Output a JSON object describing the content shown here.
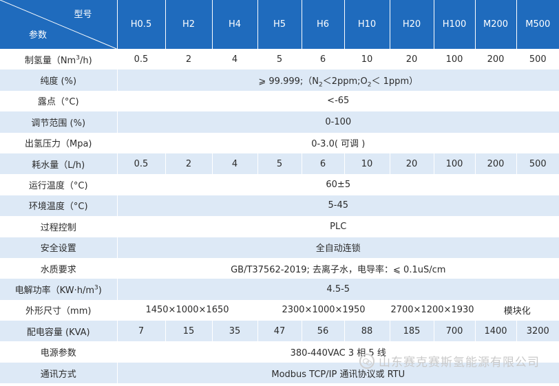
{
  "header": {
    "corner_top": "型号",
    "corner_bottom": "参数",
    "models": [
      "H0.5",
      "H2",
      "H4",
      "H5",
      "H6",
      "H10",
      "H20",
      "H100",
      "M200",
      "M500"
    ]
  },
  "rows": {
    "flow": {
      "label_pre": "制氢量（Nm",
      "label_sup": "3",
      "label_post": "/h)",
      "values": [
        "0.5",
        "2",
        "4",
        "5",
        "6",
        "10",
        "20",
        "100",
        "200",
        "500"
      ]
    },
    "purity": {
      "label": "纯度 (%)",
      "v_pre": "⩾ 99.999;（N",
      "v_sub1": "2",
      "v_mid1": "＜2ppm;O",
      "v_sub2": "2",
      "v_post": "＜ 1ppm）"
    },
    "dew_point": {
      "label": "露点（°C)",
      "value": "<-65"
    },
    "adjust_range": {
      "label": "调节范围 (%)",
      "value": "0-100"
    },
    "out_pressure": {
      "label": "出氢压力（Mpa)",
      "value": "0-3.0( 可调 )"
    },
    "water_use": {
      "label": "耗水量（L/h)",
      "values": [
        "0.5",
        "2",
        "4",
        "5",
        "6",
        "10",
        "20",
        "100",
        "200",
        "500"
      ]
    },
    "run_temp": {
      "label": "运行温度（°C)",
      "value": "60±5"
    },
    "env_temp": {
      "label": "环境温度（°C)",
      "value": "5-45"
    },
    "process_control": {
      "label": "过程控制",
      "value": "PLC"
    },
    "safety": {
      "label": "安全设置",
      "value": "全自动连锁"
    },
    "water_quality": {
      "label": "水质要求",
      "value": "GB/T37562-2019; 去离子水，电导率：⩽ 0.1uS/cm"
    },
    "power_use": {
      "label_pre": "电解功率（KW·h/m",
      "label_sup": "3",
      "label_post": ")",
      "value": "4.5-5"
    },
    "dimensions": {
      "label": "外形尺寸（mm)",
      "values": [
        "1450×1000×1650",
        "2300×1000×1950",
        "2700×1200×1930",
        "模块化"
      ]
    },
    "power_capacity": {
      "label": "配电容量 (KVA)",
      "values": [
        "7",
        "15",
        "35",
        "47",
        "56",
        "88",
        "185",
        "700",
        "1400",
        "3200"
      ]
    },
    "power_source": {
      "label": "电源参数",
      "value": "380-440VAC 3 相 5 线"
    },
    "comm": {
      "label": "通讯方式",
      "value": "Modbus TCP/IP 通讯协议或 RTU"
    }
  },
  "watermark": {
    "text": "山东赛克赛斯氢能源有限公司",
    "icon": "wechat-icon"
  }
}
